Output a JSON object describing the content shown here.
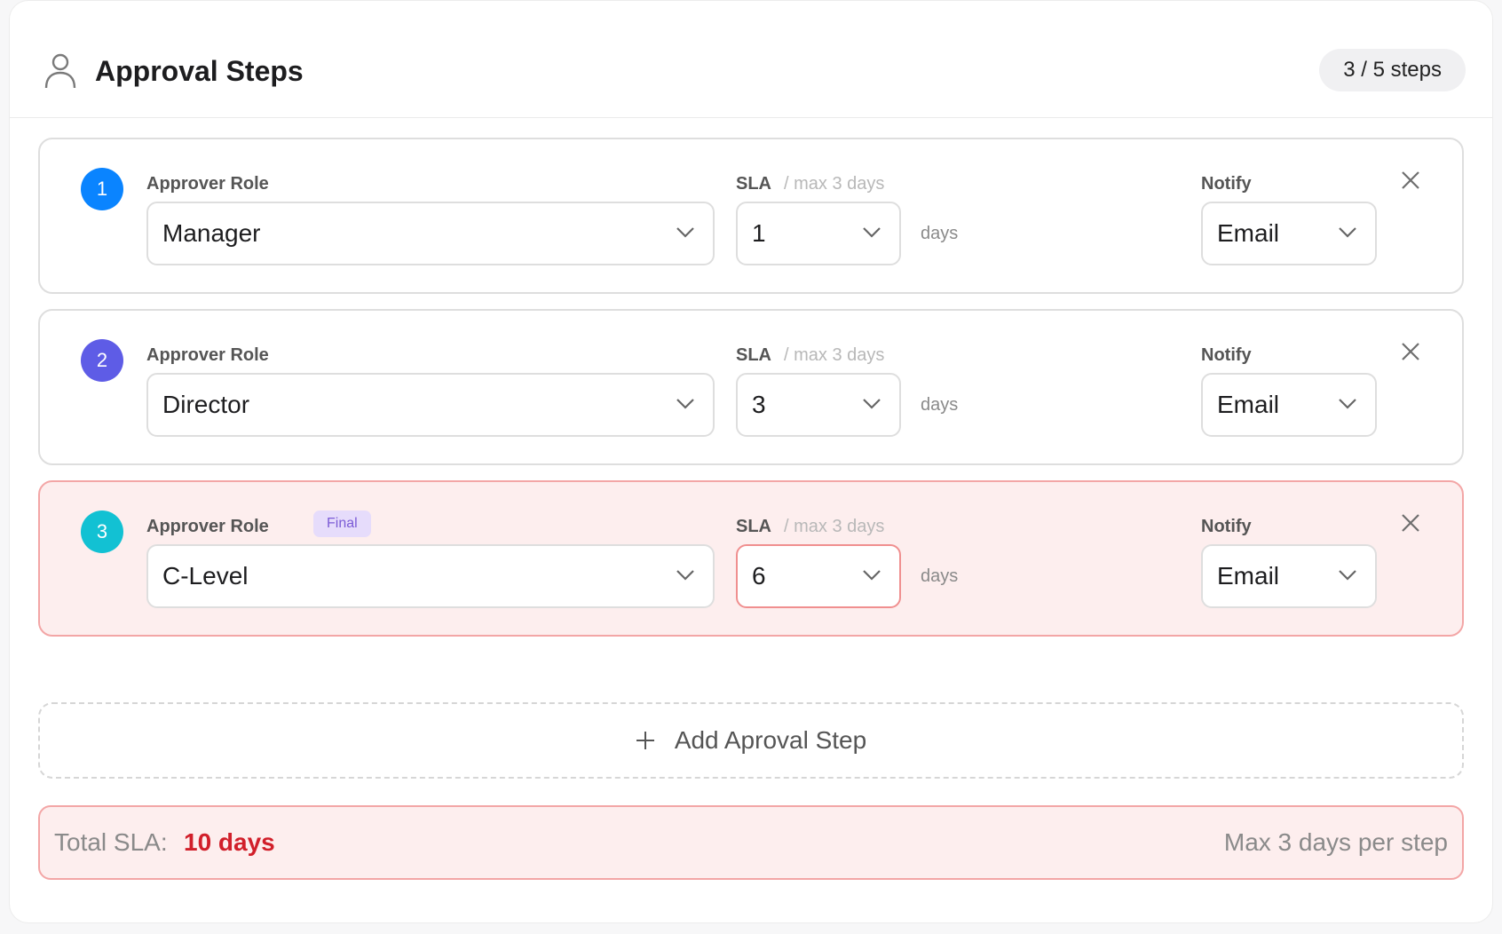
{
  "header": {
    "title": "Approval Steps",
    "icon": "user-icon",
    "step_count": "3 / 5 steps"
  },
  "labels": {
    "approver_role": "Approver Role",
    "sla": "SLA",
    "sla_hint": "/ max 3 days",
    "notify": "Notify",
    "days": "days",
    "final": "Final"
  },
  "steps": [
    {
      "number": "1",
      "color": "#0a84ff",
      "role": "Manager",
      "sla": "1",
      "notify": "Email"
    },
    {
      "number": "2",
      "color": "#5e5ce6",
      "role": "Director",
      "sla": "3",
      "notify": "Email"
    },
    {
      "number": "3",
      "color": "#12c1d3",
      "role": "C-Level",
      "sla": "6",
      "notify": "Email"
    }
  ],
  "add_step": {
    "label": "Add Aproval Step",
    "icon": "plus-icon"
  },
  "total": {
    "label": "Total SLA:",
    "value": "10 days",
    "hint": "Max 3 days per step"
  },
  "colors": {
    "error_border": "#f3a6a6",
    "error_bg": "#fdeeee",
    "error_text": "#d11f2a",
    "final_tag_bg": "#e6dcfb",
    "final_tag_text": "#7b5bd6"
  }
}
